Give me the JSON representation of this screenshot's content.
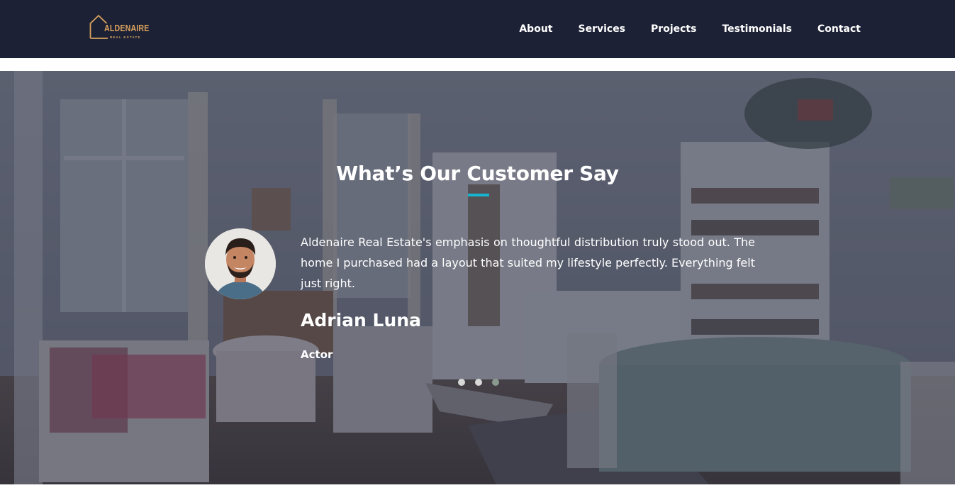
{
  "navbar": {
    "logo": {
      "name": "ALDENAIRE",
      "tagline": "REAL ESTATE"
    },
    "links": [
      "About",
      "Services",
      "Projects",
      "Testimonials",
      "Contact"
    ]
  },
  "testimonials": {
    "title": "What’s Our Customer Say",
    "current": {
      "quote": "Aldenaire Real Estate's emphasis on thoughtful distribution truly stood out. The home I purchased had a layout that suited my lifestyle perfectly. Everything felt just right.",
      "name": "Adrian Luna",
      "role": "Actor"
    },
    "slide_count": 3,
    "active_slide": 3
  },
  "colors": {
    "navbar_bg": "#1c2135",
    "accent": "#17b4d0",
    "logo_gold": "#d9a25d"
  }
}
